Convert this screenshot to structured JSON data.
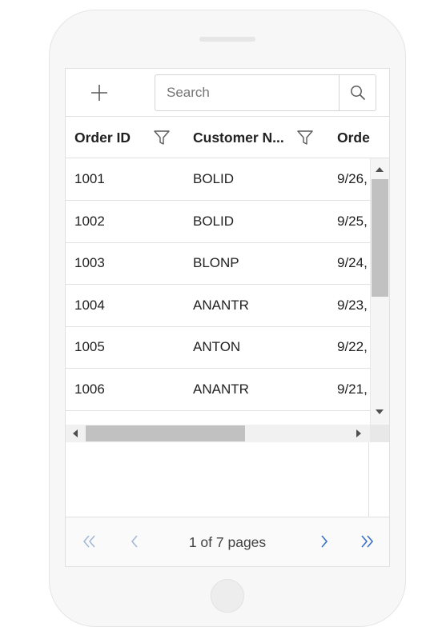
{
  "toolbar": {
    "add_icon": "plus-icon",
    "search": {
      "placeholder": "Search",
      "value": ""
    },
    "search_icon": "search-icon"
  },
  "columns": [
    {
      "label": "Order ID",
      "filter_icon": "filter-icon"
    },
    {
      "label": "Customer N...",
      "filter_icon": "filter-icon"
    },
    {
      "label": "Orde"
    }
  ],
  "rows": [
    {
      "order_id": "1001",
      "customer": "BOLID",
      "order_date": "9/26,"
    },
    {
      "order_id": "1002",
      "customer": "BOLID",
      "order_date": "9/25,"
    },
    {
      "order_id": "1003",
      "customer": "BLONP",
      "order_date": "9/24,"
    },
    {
      "order_id": "1004",
      "customer": "ANANTR",
      "order_date": "9/23,"
    },
    {
      "order_id": "1005",
      "customer": "ANTON",
      "order_date": "9/22,"
    },
    {
      "order_id": "1006",
      "customer": "ANANTR",
      "order_date": "9/21,"
    }
  ],
  "pager": {
    "info": "1 of 7 pages",
    "icons": [
      "first-page-icon",
      "previous-page-icon",
      "next-page-icon",
      "last-page-icon"
    ],
    "disabled_color": "#9fb6d6",
    "active_color": "#3b70c4"
  }
}
